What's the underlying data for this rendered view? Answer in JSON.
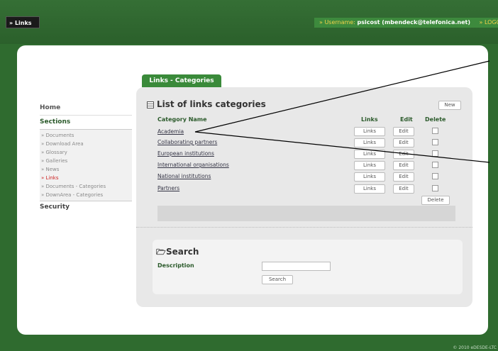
{
  "topbar": {
    "links_tab": "» Links",
    "username_label": "» Username:",
    "username_value": "psicost (mbendeck@telefonica.net)",
    "logout": "» LOGOUT"
  },
  "sidebar": {
    "home": "Home",
    "sections": "Sections",
    "items": [
      {
        "label": "» Documents"
      },
      {
        "label": "» Download Area"
      },
      {
        "label": "» Glossary"
      },
      {
        "label": "» Galleries"
      },
      {
        "label": "» News"
      },
      {
        "label": "» Links"
      },
      {
        "label": "» Documents - Categories"
      },
      {
        "label": "» DownArea - Categories"
      }
    ],
    "security": "Security"
  },
  "main": {
    "tab_label": "Links - Categories",
    "list_title": "List of links categories",
    "new_button": "New",
    "columns": {
      "name": "Category Name",
      "links": "Links",
      "edit": "Edit",
      "delete": "Delete"
    },
    "rows": [
      {
        "name": "Academia",
        "links": "Links",
        "edit": "Edit"
      },
      {
        "name": "Collaborating partners",
        "links": "Links",
        "edit": "Edit"
      },
      {
        "name": "European institutions",
        "links": "Links",
        "edit": "Edit"
      },
      {
        "name": "International organisations",
        "links": "Links",
        "edit": "Edit"
      },
      {
        "name": "National institutions",
        "links": "Links",
        "edit": "Edit"
      },
      {
        "name": "Partners",
        "links": "Links",
        "edit": "Edit"
      }
    ],
    "delete_button": "Delete",
    "search": {
      "title": "Search",
      "description_label": "Description",
      "description_value": "",
      "search_button": "Search"
    }
  },
  "footer": {
    "copyright": "© 2010 eDESDE-LTC"
  },
  "colors": {
    "frame_green": "#2f6b2f",
    "tab_green": "#3a8a3a",
    "active_red": "#cc2222",
    "label_yellow": "#f2d24a"
  }
}
